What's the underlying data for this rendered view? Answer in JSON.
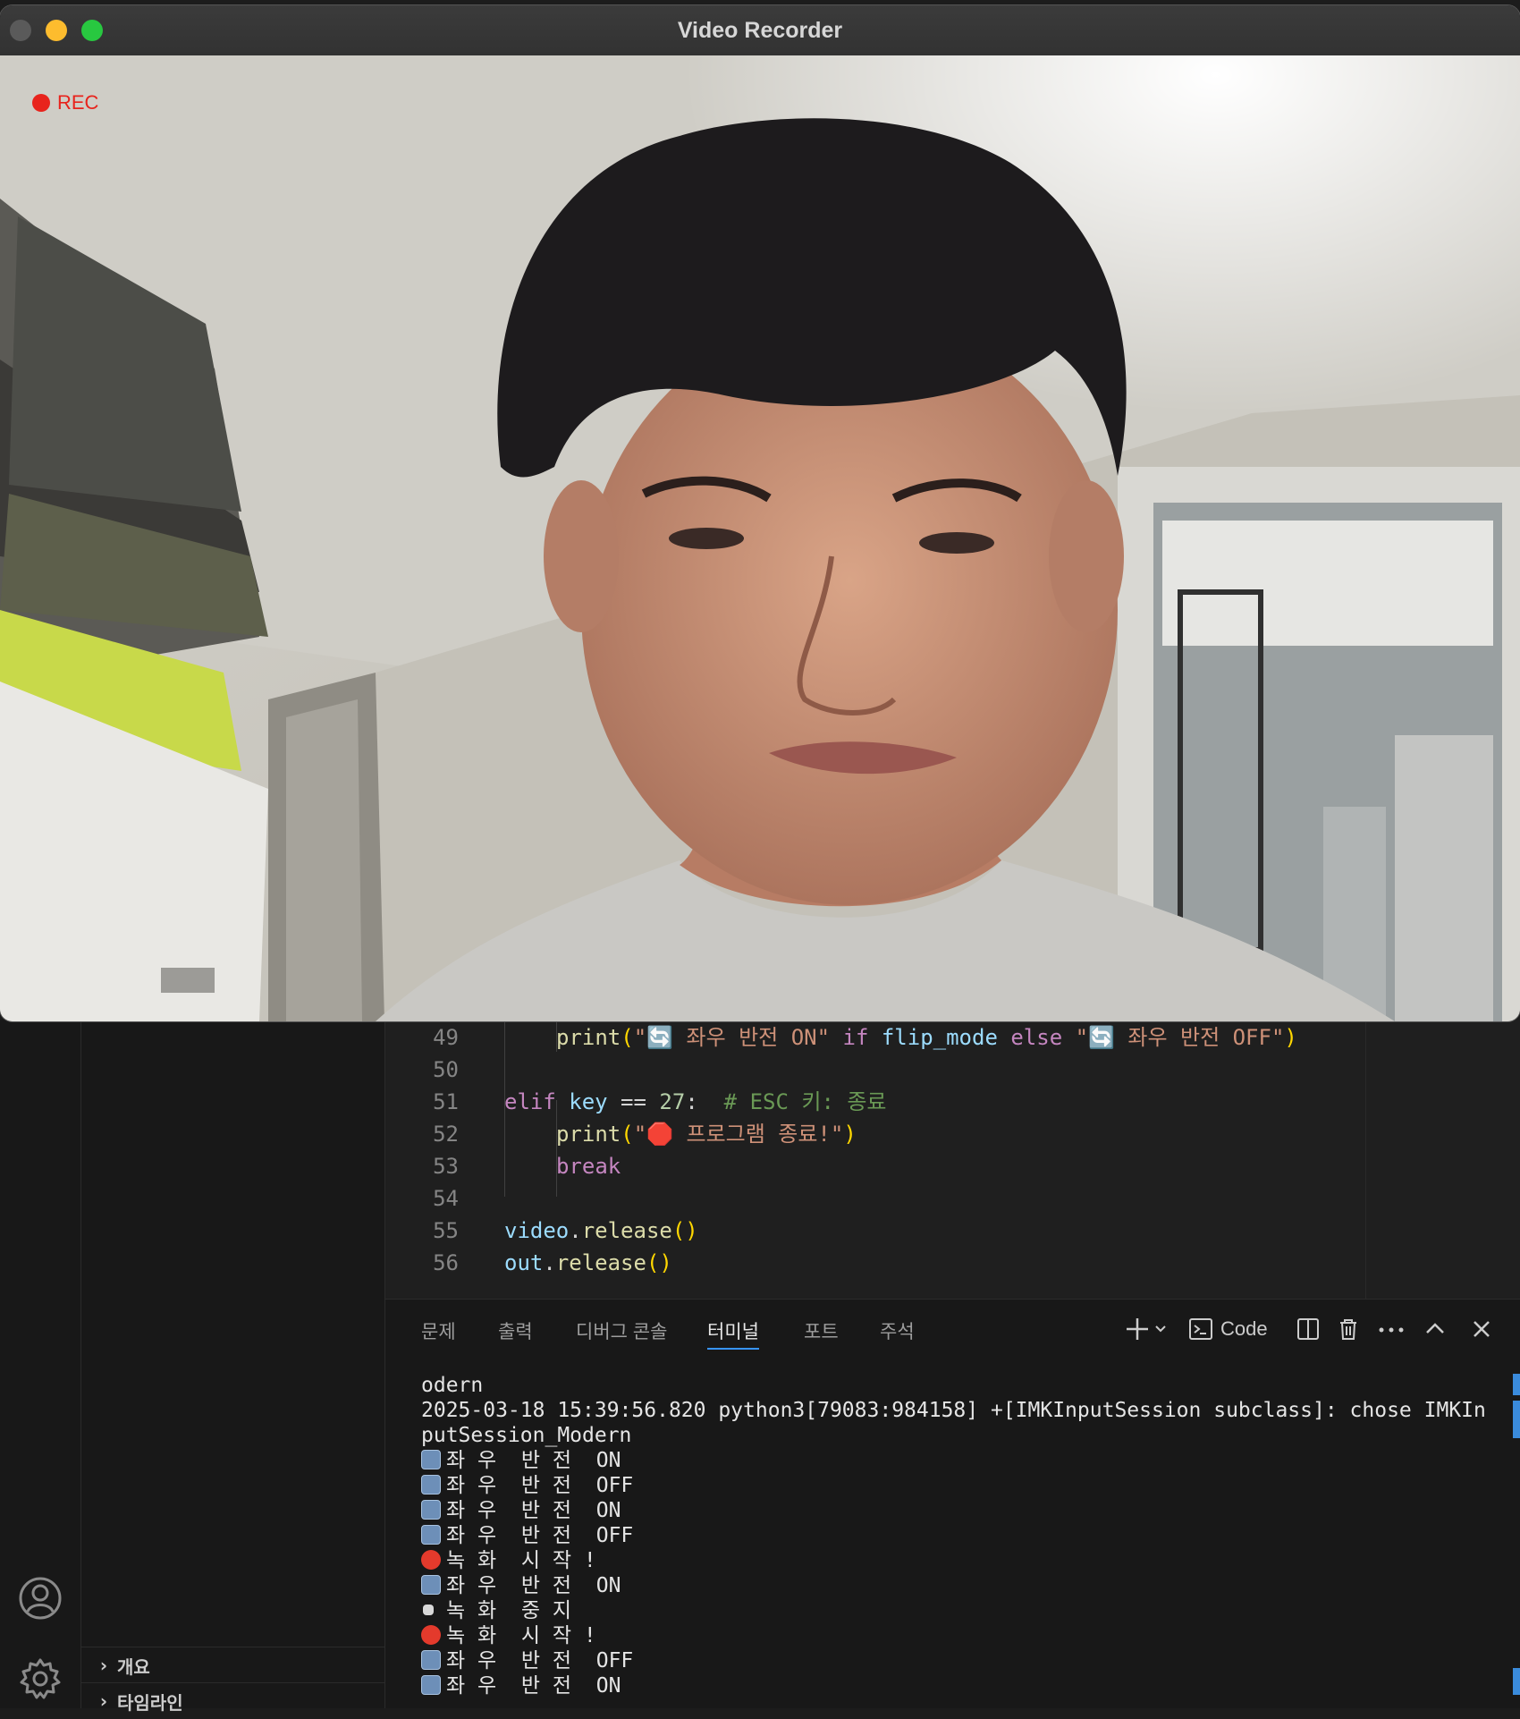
{
  "window": {
    "title": "Video Recorder",
    "rec_label": "REC"
  },
  "editor": {
    "line_numbers": [
      "49",
      "50",
      "51",
      "52",
      "53",
      "54",
      "55",
      "56"
    ],
    "lines": [
      {
        "parts": [
          [
            "fn",
            "print"
          ],
          [
            "pu",
            "("
          ],
          [
            "str",
            "\"🔄 좌우 반전 ON\" "
          ],
          [
            "kw",
            "if "
          ],
          [
            "var",
            "flip_mode "
          ],
          [
            "kw",
            "else "
          ],
          [
            "str",
            "\"🔄 좌우 반전 OFF\""
          ],
          [
            "pu",
            ")"
          ]
        ]
      },
      {
        "parts": []
      },
      {
        "parts": [
          [
            "kw",
            "elif "
          ],
          [
            "var",
            "key "
          ],
          [
            "op",
            "== "
          ],
          [
            "num",
            "27"
          ],
          [
            "op",
            ":  "
          ],
          [
            "cm",
            "# ESC 키: 종료"
          ]
        ]
      },
      {
        "parts": [
          [
            "fn",
            "print"
          ],
          [
            "pu",
            "("
          ],
          [
            "str",
            "\"🛑 프로그램 종료!\""
          ],
          [
            "pu",
            ")"
          ]
        ]
      },
      {
        "parts": [
          [
            "kw",
            "break"
          ]
        ]
      },
      {
        "parts": []
      },
      {
        "parts": [
          [
            "var",
            "video"
          ],
          [
            "op",
            "."
          ],
          [
            "fn",
            "release"
          ],
          [
            "pu",
            "()"
          ]
        ]
      },
      {
        "parts": [
          [
            "var",
            "out"
          ],
          [
            "op",
            "."
          ],
          [
            "fn",
            "release"
          ],
          [
            "pu",
            "()"
          ]
        ]
      }
    ]
  },
  "panel": {
    "tabs": [
      "문제",
      "출력",
      "디버그 콘솔",
      "터미널",
      "포트",
      "주석"
    ],
    "active_tab": "터미널",
    "terminal_profile": "Code",
    "terminal_lines": [
      {
        "icon": "",
        "text": "odern"
      },
      {
        "icon": "",
        "text": "2025-03-18 15:39:56.820 python3[79083:984158] +[IMKInputSession subclass]: chose IMKIn"
      },
      {
        "icon": "",
        "text": "putSession_Modern"
      },
      {
        "icon": "cyc",
        "text": "좌 우  반 전  ON"
      },
      {
        "icon": "cyc",
        "text": "좌 우  반 전  OFF"
      },
      {
        "icon": "cyc",
        "text": "좌 우  반 전  ON"
      },
      {
        "icon": "cyc",
        "text": "좌 우  반 전  OFF"
      },
      {
        "icon": "rec",
        "text": "녹 화  시 작 !"
      },
      {
        "icon": "cyc",
        "text": "좌 우  반 전  ON"
      },
      {
        "icon": "stop",
        "text": "녹 화  중 지"
      },
      {
        "icon": "rec",
        "text": "녹 화  시 작 !"
      },
      {
        "icon": "cyc",
        "text": "좌 우  반 전  OFF"
      },
      {
        "icon": "cyc",
        "text": "좌 우  반 전  ON"
      }
    ]
  },
  "sidebar": {
    "sections": [
      "개요",
      "타임라인"
    ]
  },
  "icons": {
    "account": "account-icon",
    "settings": "gear-icon",
    "new_terminal": "plus-icon",
    "split": "split-icon",
    "trash": "trash-icon",
    "more": "ellipsis-icon",
    "maximize": "chevron-up-icon",
    "close": "close-icon"
  },
  "colors": {
    "rec": "#e8231c",
    "active_tab_border": "#3794ff"
  }
}
